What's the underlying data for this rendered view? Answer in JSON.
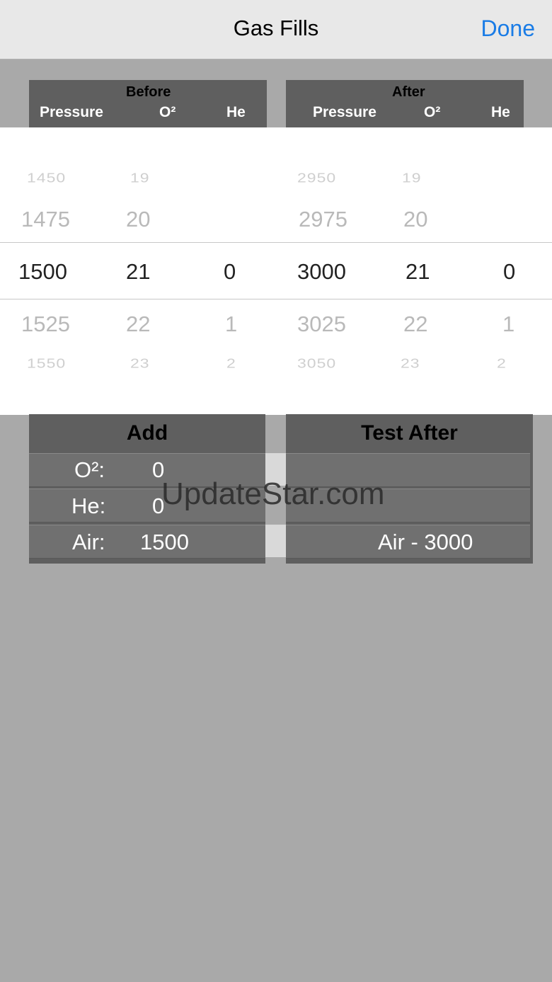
{
  "nav": {
    "title": "Gas Fills",
    "done_label": "Done"
  },
  "before": {
    "title": "Before",
    "col_pressure": "Pressure",
    "col_o2": "O²",
    "col_he": "He"
  },
  "after": {
    "title": "After",
    "col_pressure": "Pressure",
    "col_o2": "O²",
    "col_he": "He"
  },
  "picker": {
    "before_pressure": [
      "1450",
      "1475",
      "1500",
      "1525",
      "1550"
    ],
    "before_o2": [
      "19",
      "20",
      "21",
      "22",
      "23"
    ],
    "before_he": [
      "0",
      "1",
      "2"
    ],
    "after_pressure": [
      "2950",
      "2975",
      "3000",
      "3025",
      "3050"
    ],
    "after_o2": [
      "19",
      "20",
      "21",
      "22",
      "23"
    ],
    "after_he": [
      "0",
      "1",
      "2"
    ]
  },
  "add": {
    "title": "Add",
    "o2_label": "O²:",
    "o2_value": "0",
    "he_label": "He:",
    "he_value": "0",
    "air_label": "Air:",
    "air_value": "1500"
  },
  "test_after": {
    "title": "Test After",
    "row1": "",
    "row2": "",
    "row3": "Air - 3000"
  },
  "watermark": "UpdateStar.com"
}
